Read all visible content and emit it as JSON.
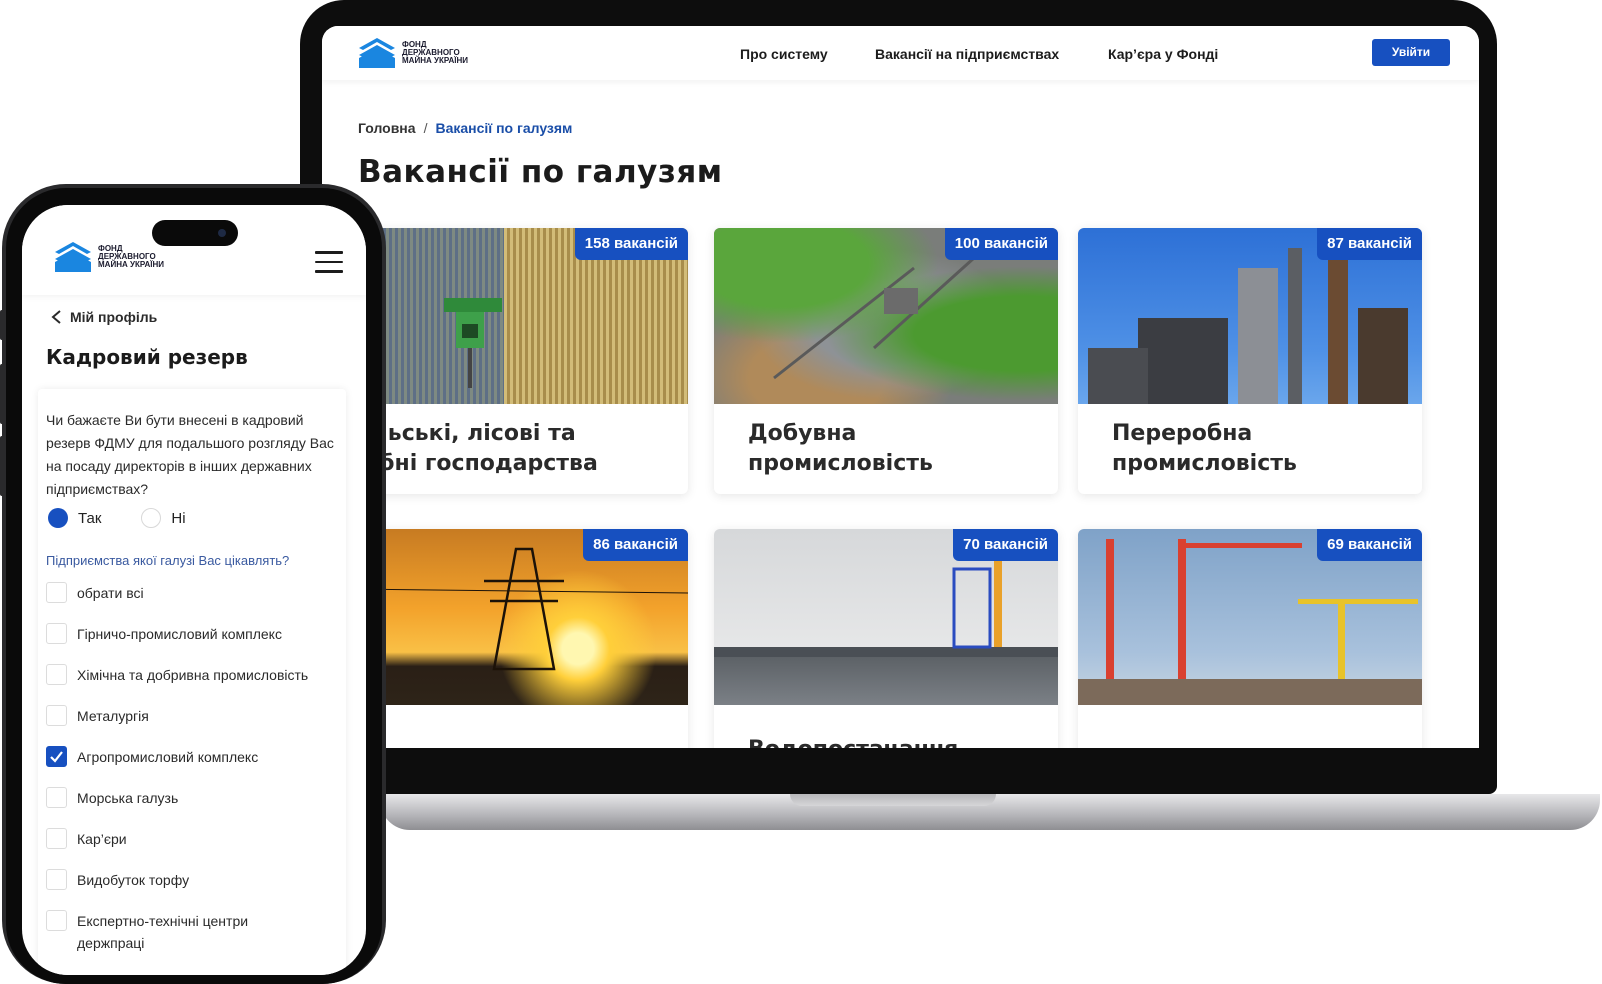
{
  "brand": {
    "logo_text": "Фонд державного майна України",
    "accent": "#1750c0"
  },
  "laptop": {
    "nav": [
      "Про систему",
      "Вакансії на підприємствах",
      "Кар’єра у Фонді"
    ],
    "login_label": "Увійти",
    "breadcrumb": {
      "home": "Головна",
      "separator": "/",
      "current": "Вакансії по галузям"
    },
    "page_title": "Вакансії по галузям",
    "cards": [
      {
        "badge": "158 вакансій",
        "title": "Сільські, лісові та рибні господарства",
        "image": "agriculture-field-photo"
      },
      {
        "badge": "100 вакансій",
        "title": "Добувна промисловість",
        "image": "mining-quarry-photo"
      },
      {
        "badge": "87 вакансій",
        "title": "Переробна промисловість",
        "image": "processing-plant-photo"
      },
      {
        "badge": "86 вакансій",
        "title": "",
        "image": "power-line-sunset-photo"
      },
      {
        "badge": "70 вакансій",
        "title": "Водопостачання",
        "image": "water-pier-photo"
      },
      {
        "badge": "69 вакансій",
        "title": "",
        "image": "construction-cranes-photo"
      }
    ]
  },
  "phone": {
    "back_label": "Мій профіль",
    "title": "Кадровий резерв",
    "question": "Чи бажаєте Ви бути внесені в кадровий резерв ФДМУ для подальшого розгляду Вас на посаду директорів в інших державних підприємствах?",
    "radio": [
      {
        "label": "Так",
        "selected": true
      },
      {
        "label": "Ні",
        "selected": false
      }
    ],
    "sub_question": "Підприємства якої галузі Вас цікавлять?",
    "checkboxes": [
      {
        "label": "обрати всі",
        "checked": false
      },
      {
        "label": "Гірничо-промисловий комплекс",
        "checked": false
      },
      {
        "label": "Хімічна та добривна промисловість",
        "checked": false
      },
      {
        "label": "Металургія",
        "checked": false
      },
      {
        "label": "Агропромисловий комплекс",
        "checked": true
      },
      {
        "label": "Морська галузь",
        "checked": false
      },
      {
        "label": "Кар’єри",
        "checked": false
      },
      {
        "label": "Видобуток торфу",
        "checked": false
      },
      {
        "label": "Експертно-технічні центри держпраці",
        "checked": false
      }
    ]
  }
}
